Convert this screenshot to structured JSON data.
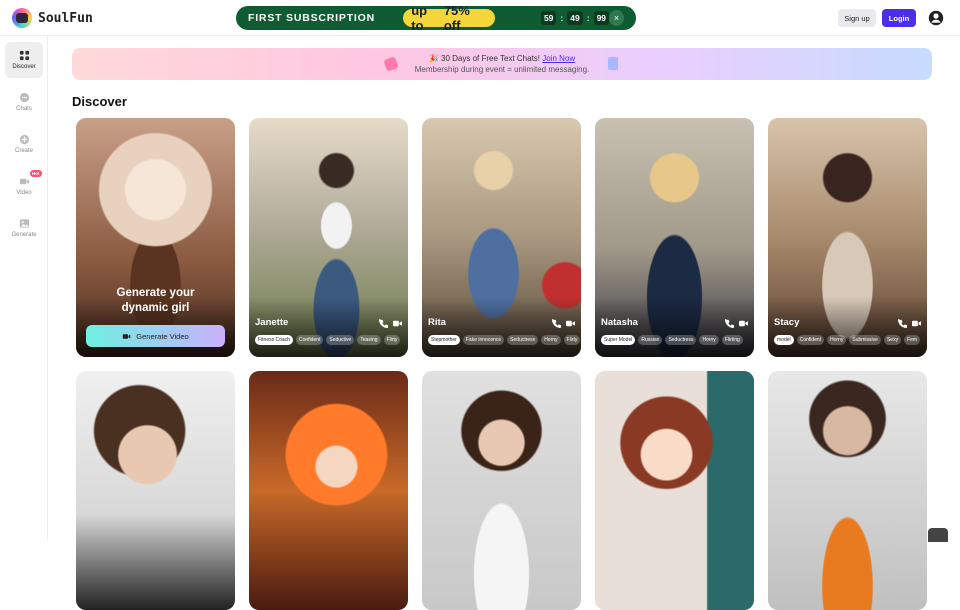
{
  "app": {
    "name": "SoulFun"
  },
  "promo": {
    "title": "FIRST SUBSCRIPTION",
    "offer_prefix": "up to",
    "offer_value": "75% off",
    "timer": [
      "59",
      "49",
      "99"
    ],
    "close": "×"
  },
  "header": {
    "signup": "Sign up",
    "login": "Login"
  },
  "sidebar": {
    "items": [
      {
        "label": "Discover",
        "icon": "grid-icon"
      },
      {
        "label": "Chats",
        "icon": "chat-icon"
      },
      {
        "label": "Create",
        "icon": "plus-icon"
      },
      {
        "label": "Video",
        "icon": "video-icon",
        "badge": "Hot"
      },
      {
        "label": "Generate",
        "icon": "image-icon"
      }
    ]
  },
  "banner": {
    "line1": "🎉 30 Days of Free Text Chats!",
    "link": "Join Now",
    "line2": "Membership during event = unlimited messaging."
  },
  "section": {
    "title": "Discover"
  },
  "generate_card": {
    "line1": "Generate your",
    "line2": "dynamic girl",
    "button": "Generate Video"
  },
  "characters": [
    {
      "name": "Janette",
      "tags": [
        "Fitness Coach",
        "Confident",
        "Seductive",
        "Teasing",
        "Flirty"
      ]
    },
    {
      "name": "Rita",
      "tags": [
        "Stepmother",
        "Fake innocence",
        "Seductress",
        "Horny",
        "Flirty"
      ]
    },
    {
      "name": "Natasha",
      "tags": [
        "Super Model",
        "Russian",
        "Seductress",
        "Horny",
        "Flirting"
      ]
    },
    {
      "name": "Stacy",
      "tags": [
        "model",
        "Confident",
        "Horny",
        "Submissive",
        "Sexy",
        "Fem"
      ]
    }
  ],
  "colors": {
    "accent": "#4b2fe8",
    "promo_bg": "#0f5c33",
    "promo_offer": "#f4d53a"
  }
}
